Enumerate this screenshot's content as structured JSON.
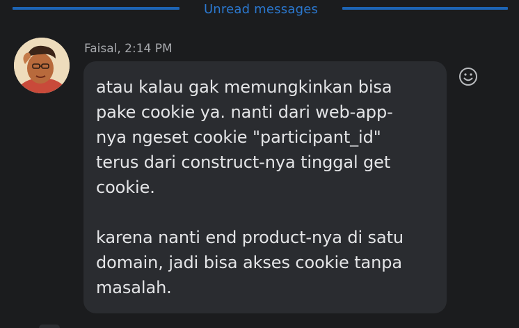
{
  "divider": {
    "label": "Unread messages",
    "color": "#1d64b4"
  },
  "message": {
    "author": "Faisal",
    "time": "2:14 PM",
    "meta": "Faisal, 2:14 PM",
    "text": "atau kalau gak memungkinkan bisa\npake cookie ya. nanti dari web-app-\nnya ngeset cookie \"participant_id\"\nterus dari construct-nya tinggal get\ncookie.\n\nkarena nanti end product-nya di satu\ndomain, jadi bisa akses cookie tanpa\nmasalah.",
    "avatar_icon": "user-avatar",
    "reaction_icon": "smiley-icon"
  },
  "theme": {
    "background": "#1b1c1e",
    "bubble": "#2a2c30",
    "text": "#e4e5e7",
    "meta_text": "#a7a9ad",
    "accent": "#2b78cf"
  }
}
